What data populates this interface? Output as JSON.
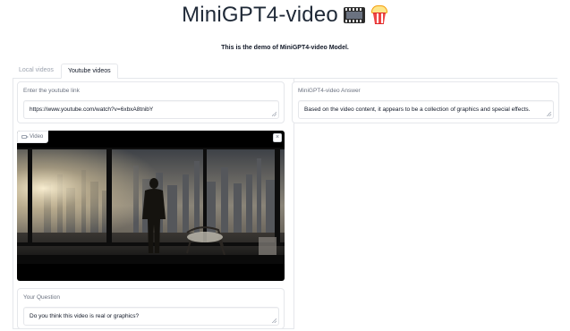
{
  "header": {
    "title": "MiniGPT4-video",
    "title_icons": [
      "film-frames-icon",
      "popcorn-icon"
    ],
    "subtitle": "This is the demo of MiniGPT4-video Model."
  },
  "tabs": [
    {
      "label": "Local videos",
      "active": false
    },
    {
      "label": "Youtube videos",
      "active": true
    }
  ],
  "youtube_link": {
    "label": "Enter the youtube link",
    "value": "https://www.youtube.com/watch?v=6xbxA8tnibY"
  },
  "answer": {
    "label": "MiniGPT4-video Answer",
    "value": "Based on the video content, it appears to be a collection of graphics and special effects."
  },
  "video": {
    "label": "Video"
  },
  "question": {
    "label": "Your Question",
    "value": "Do you think this video is real or graphics?"
  },
  "colors": {
    "border": "#e5e7eb",
    "label": "#6b7280",
    "text": "#111827"
  }
}
